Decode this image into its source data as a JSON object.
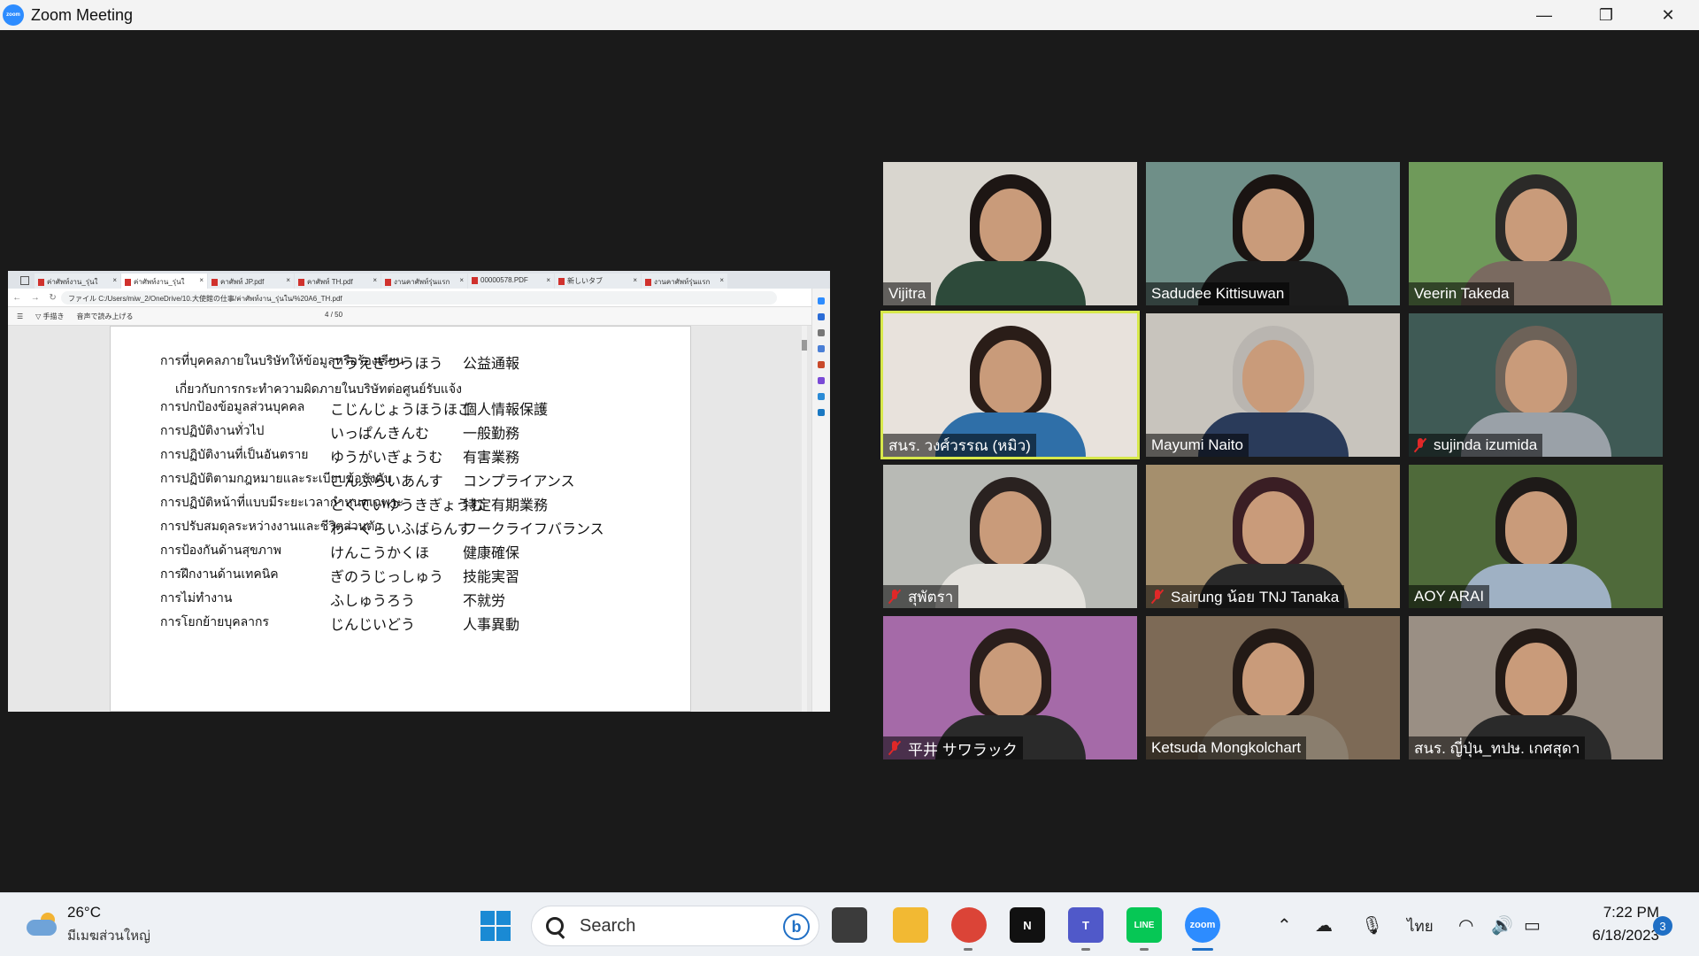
{
  "window": {
    "title": "Zoom Meeting",
    "controls": [
      "—",
      "❐",
      "✕"
    ]
  },
  "browser": {
    "tabs": [
      "ค่าศัพท์งาน_รุ่นใ",
      "ค่าศัพท์งาน_รุ่นใ",
      "คาศัพท์ JP.pdf",
      "คาศัพท์ TH.pdf",
      "งานคาศัพท์รุ่นแรก",
      "00000578.PDF",
      "新しいタブ",
      "งานคาศัพท์รุ่นแรก"
    ],
    "url": "ファイル   C:/Users/miw_2/OneDrive/10.大使館の仕事/ค่าศัพท์งาน_รุ่นใน/%20A6_TH.pdf",
    "tool_draw": "手描き",
    "tool_read": "音声で読み上げる",
    "page_current": "4",
    "page_total": "/ 50"
  },
  "document": {
    "sub_line": "เกี่ยวกับการกระทำความผิดภายในบริษัทต่อศูนย์รับแจ้ง",
    "rows": [
      {
        "th": "การที่บุคคลภายในบริษัทให้ข้อมูลหรือร้องเรียน",
        "kana": "こうえきつうほう",
        "kanji": "公益通報"
      },
      {
        "th": "การปกป้องข้อมูลส่วนบุคคล",
        "kana": "こじんじょうほうほご",
        "kanji": "個人情報保護"
      },
      {
        "th": "การปฏิบัติงานทั่วไป",
        "kana": "いっぱんきんむ",
        "kanji": "一般勤務"
      },
      {
        "th": "การปฏิบัติงานที่เป็นอันตราย",
        "kana": "ゆうがいぎょうむ",
        "kanji": "有害業務"
      },
      {
        "th": "การปฏิบัติตามกฎหมายและระเบียบข้อบังคับ",
        "kana": "こんぷらいあんす",
        "kanji": "コンプライアンス"
      },
      {
        "th": "การปฏิบัติหน้าที่แบบมีระยะเวลากำหนดเฉพาะ",
        "kana": "とくていゆうきぎょうむ",
        "kanji": "特定有期業務"
      },
      {
        "th": "การปรับสมดุลระหว่างงานและชีวิตส่วนตัว",
        "kana": "わーくらいふばらんす",
        "kanji": "ワークライフバランス"
      },
      {
        "th": "การป้องกันด้านสุขภาพ",
        "kana": "けんこうかくほ",
        "kanji": "健康確保"
      },
      {
        "th": "การฝึกงานด้านเทคนิค",
        "kana": "ぎのうじっしゅう",
        "kanji": "技能実習"
      },
      {
        "th": "การไม่ทำงาน",
        "kana": "ふしゅうろう",
        "kanji": "不就労"
      },
      {
        "th": "การโยกย้ายบุคลากร",
        "kana": "じんじいどう",
        "kanji": "人事異動"
      }
    ]
  },
  "participants": [
    {
      "name": "Vijitra",
      "muted": false,
      "bg": "#d9d6cf",
      "hair": "#1d1614",
      "body": "#2d4a3a"
    },
    {
      "name": "Sadudee Kittisuwan",
      "muted": false,
      "bg": "#6f8f88",
      "hair": "#1a1412",
      "body": "#1c1c1c"
    },
    {
      "name": "Veerin Takeda",
      "muted": false,
      "bg": "#6f9a5a",
      "hair": "#2b2a28",
      "body": "#7a6a60"
    },
    {
      "name": "สนร. วงศ์วรรณ (หมิว)",
      "muted": false,
      "bg": "#e8e2dc",
      "hair": "#2a1d18",
      "body": "#2f6fa8"
    },
    {
      "name": "Mayumi Naito",
      "muted": false,
      "bg": "#c8c4bd",
      "hair": "#b9b5b0",
      "body": "#2a3b5a"
    },
    {
      "name": "sujinda izumida",
      "muted": true,
      "bg": "#3f5a55",
      "hair": "#6d6258",
      "body": "#9aa1a8"
    },
    {
      "name": "สุพัตรา",
      "muted": true,
      "bg": "#b8bab5",
      "hair": "#2a2220",
      "body": "#e4e2dd"
    },
    {
      "name": "Sairung  น้อย TNJ Tanaka",
      "muted": true,
      "bg": "#a58f6d",
      "hair": "#3a1e24",
      "body": "#2a2a2a"
    },
    {
      "name": "AOY ARAI",
      "muted": false,
      "bg": "#4f6a3a",
      "hair": "#1e1a18",
      "body": "#9fb1c4"
    },
    {
      "name": "平井  サワラック",
      "muted": true,
      "bg": "#a56aa8",
      "hair": "#2a1e1c",
      "body": "#2a2a2a"
    },
    {
      "name": "Ketsuda Mongkolchart",
      "muted": false,
      "bg": "#7d6a56",
      "hair": "#231a16",
      "body": "#8a7e6e"
    },
    {
      "name": "สนร. ญี่ปุ่น_ทปษ. เกศสุดา",
      "muted": false,
      "bg": "#9a8f84",
      "hair": "#231a16",
      "body": "#2a2a2a"
    }
  ],
  "taskbar": {
    "temperature": "26°C",
    "weather": "มีเมฆส่วนใหญ่",
    "search_label": "Search",
    "language": "ไทย",
    "time": "7:22 PM",
    "date": "6/18/2023",
    "notifications": "3",
    "apps": [
      {
        "name": "task-view",
        "label": "",
        "color": "#3b3b3b"
      },
      {
        "name": "file-explorer",
        "label": "",
        "color": "#f2b933"
      },
      {
        "name": "chrome",
        "label": "",
        "color": "#db4437"
      },
      {
        "name": "netflix",
        "label": "N",
        "color": "#111111"
      },
      {
        "name": "teams",
        "label": "T",
        "color": "#5059c9"
      },
      {
        "name": "line",
        "label": "LINE",
        "color": "#06c755"
      },
      {
        "name": "zoom",
        "label": "zoom",
        "color": "#2d8cff"
      }
    ]
  }
}
